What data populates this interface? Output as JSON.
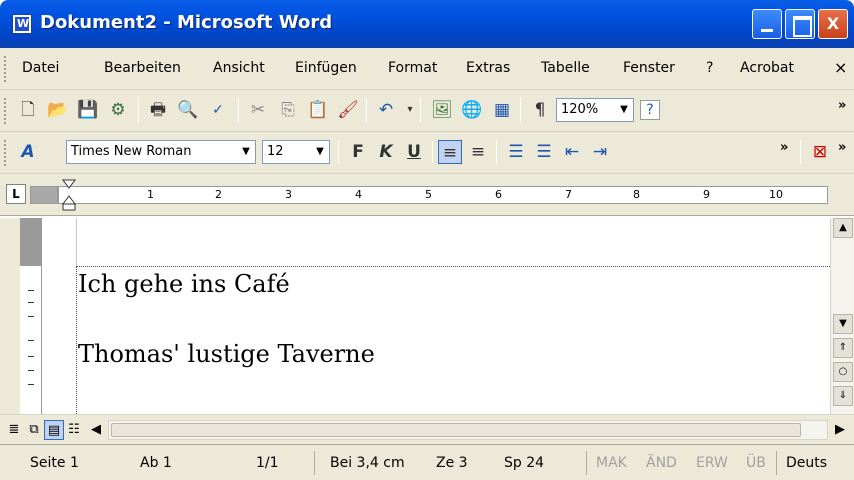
{
  "window": {
    "title": "Dokument2 - Microsoft Word",
    "minimize": "_",
    "maximize": "□",
    "close": "X"
  },
  "menubar": {
    "items": [
      {
        "label": "Datei"
      },
      {
        "label": "Bearbeiten"
      },
      {
        "label": "Ansicht"
      },
      {
        "label": "Einfügen"
      },
      {
        "label": "Format"
      },
      {
        "label": "Extras"
      },
      {
        "label": "Tabelle"
      },
      {
        "label": "Fenster"
      },
      {
        "label": "?"
      },
      {
        "label": "Acrobat"
      }
    ],
    "close_glyph": "×"
  },
  "standard_toolbar": {
    "zoom": "120%",
    "icons": [
      "new-document-icon",
      "open-folder-icon",
      "save-disk-icon",
      "permission-icon",
      "print-icon",
      "print-preview-icon",
      "spelling-icon",
      "cut-icon",
      "copy-icon",
      "paste-icon",
      "format-painter-icon",
      "undo-icon",
      "insert-picture-icon",
      "hyperlink-icon",
      "table-icon",
      "pilcrow-icon",
      "help-icon"
    ]
  },
  "formatting_toolbar": {
    "font": "Times New Roman",
    "size": "12",
    "bold": "F",
    "italic": "K",
    "underline": "U"
  },
  "ruler": {
    "numbers": [
      "1",
      "2",
      "3",
      "4",
      "5",
      "6",
      "7",
      "8",
      "9",
      "10"
    ]
  },
  "document": {
    "lines": [
      "Ich gehe ins Café",
      "Thomas' lustige Taverne"
    ]
  },
  "statusbar": {
    "page": "Seite 1",
    "section": "Ab 1",
    "page_of": "1/1",
    "position": "Bei 3,4 cm",
    "line": "Ze 3",
    "column": "Sp 24",
    "mak": "MAK",
    "aend": "ÄND",
    "erw": "ERW",
    "ueb": "ÜB",
    "language": "Deuts"
  }
}
